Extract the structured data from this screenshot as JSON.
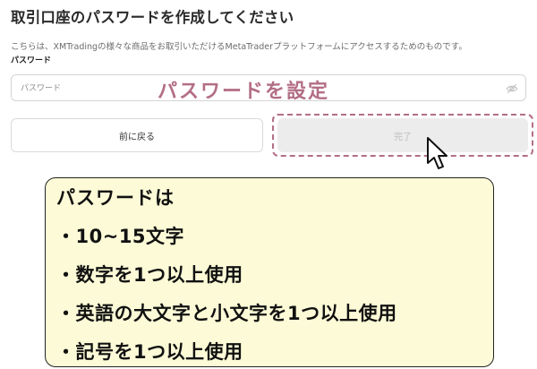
{
  "page": {
    "title": "取引口座のパスワードを作成してください",
    "description": "こちらは、XMTradingの様々な商品をお取引いただけるMetaTraderプラットフォームにアクセスするためのものです。",
    "password_label": "パスワード"
  },
  "password_field": {
    "placeholder": "パスワード",
    "value": "",
    "toggle_icon": "eye-off-icon"
  },
  "buttons": {
    "back_label": "前に戻る",
    "done_label": "完了"
  },
  "annotations": {
    "set_password": "パスワードを設定",
    "rules_title": "パスワードは",
    "rules": [
      "・10~15文字",
      "・数字を1つ以上使用",
      "・英語の大文字と小文字を1つ以上使用",
      "・記号を1つ以上使用"
    ],
    "accent_color": "#b36e86",
    "note_background": "#fdfbd7"
  }
}
